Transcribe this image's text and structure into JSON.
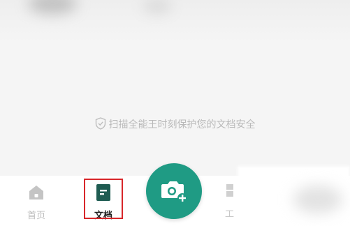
{
  "security_notice": {
    "text": "扫描全能王时刻保护您的文档安全",
    "icon": "shield-check-icon"
  },
  "tabbar": {
    "tabs": [
      {
        "label": "首页",
        "icon": "home-icon",
        "active": false
      },
      {
        "label": "文档",
        "icon": "document-icon",
        "active": true
      },
      {
        "label": "工",
        "icon": "tools-icon",
        "active": false
      }
    ],
    "camera_button": {
      "icon": "camera-plus-icon"
    }
  },
  "colors": {
    "accent": "#1f9b84",
    "highlight": "#d8262a",
    "muted_text": "#b9b9b9"
  }
}
